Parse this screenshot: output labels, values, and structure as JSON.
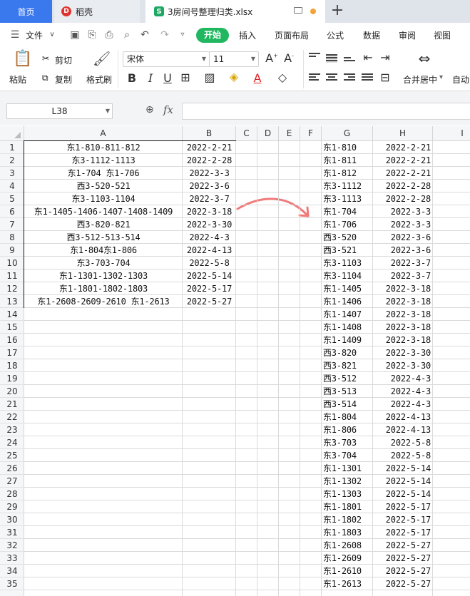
{
  "tabs": {
    "home": "首页",
    "daoke": "稻壳",
    "file": "3房间号整理归类.xlsx",
    "add": "+"
  },
  "menu": {
    "file": "文件",
    "start": "开始",
    "insert": "插入",
    "page_layout": "页面布局",
    "formula": "公式",
    "data": "数据",
    "review": "审阅",
    "view": "视图"
  },
  "ribbon": {
    "paste": "粘贴",
    "cut": "剪切",
    "copy": "复制",
    "format_painter": "格式刷",
    "font_name": "宋体",
    "font_size": "11",
    "merge_center": "合并居中",
    "auto": "自动"
  },
  "formula_bar": {
    "cell_ref": "L38",
    "fx": "fx"
  },
  "columns": [
    "A",
    "B",
    "C",
    "D",
    "E",
    "F",
    "G",
    "H",
    "I"
  ],
  "rows": [
    "1",
    "2",
    "3",
    "4",
    "5",
    "6",
    "7",
    "8",
    "9",
    "10",
    "11",
    "12",
    "13",
    "14",
    "15",
    "16",
    "17",
    "18",
    "19",
    "20",
    "21",
    "22",
    "23",
    "24",
    "25",
    "26",
    "27",
    "28",
    "29",
    "30",
    "31",
    "32",
    "33",
    "34",
    "35"
  ],
  "colA": [
    "东1-810-811-812",
    "东3-1112-1113",
    "东1-704 东1-706",
    "西3-520-521",
    "东3-1103-1104",
    "东1-1405-1406-1407-1408-1409",
    "西3-820-821",
    "西3-512-513-514",
    "东1-804东1-806",
    "东3-703-704",
    "东1-1301-1302-1303",
    "东1-1801-1802-1803",
    "东1-2608-2609-2610 东1-2613"
  ],
  "colB": [
    "2022-2-21",
    "2022-2-28",
    "2022-3-3",
    "2022-3-6",
    "2022-3-7",
    "2022-3-18",
    "2022-3-30",
    "2022-4-3",
    "2022-4-13",
    "2022-5-8",
    "2022-5-14",
    "2022-5-17",
    "2022-5-27"
  ],
  "colG": [
    "东1-810",
    "东1-811",
    "东1-812",
    "东3-1112",
    "东3-1113",
    "东1-704",
    "东1-706",
    "西3-520",
    "西3-521",
    "东3-1103",
    "东3-1104",
    "东1-1405",
    "东1-1406",
    "东1-1407",
    "东1-1408",
    "东1-1409",
    "西3-820",
    "西3-821",
    "西3-512",
    "西3-513",
    "西3-514",
    "东1-804",
    "东1-806",
    "东3-703",
    "东3-704",
    "东1-1301",
    "东1-1302",
    "东1-1303",
    "东1-1801",
    "东1-1802",
    "东1-1803",
    "东1-2608",
    "东1-2609",
    "东1-2610",
    "东1-2613"
  ],
  "colH": [
    "2022-2-21",
    "2022-2-21",
    "2022-2-21",
    "2022-2-28",
    "2022-2-28",
    "2022-3-3",
    "2022-3-3",
    "2022-3-6",
    "2022-3-6",
    "2022-3-7",
    "2022-3-7",
    "2022-3-18",
    "2022-3-18",
    "2022-3-18",
    "2022-3-18",
    "2022-3-18",
    "2022-3-30",
    "2022-3-30",
    "2022-4-3",
    "2022-4-3",
    "2022-4-3",
    "2022-4-13",
    "2022-4-13",
    "2022-5-8",
    "2022-5-8",
    "2022-5-14",
    "2022-5-14",
    "2022-5-14",
    "2022-5-17",
    "2022-5-17",
    "2022-5-17",
    "2022-5-27",
    "2022-5-27",
    "2022-5-27",
    "2022-5-27"
  ],
  "colors": {
    "tab_active": "#3a78ee",
    "start_button": "#20b760",
    "arrow": "#f07a7a"
  }
}
